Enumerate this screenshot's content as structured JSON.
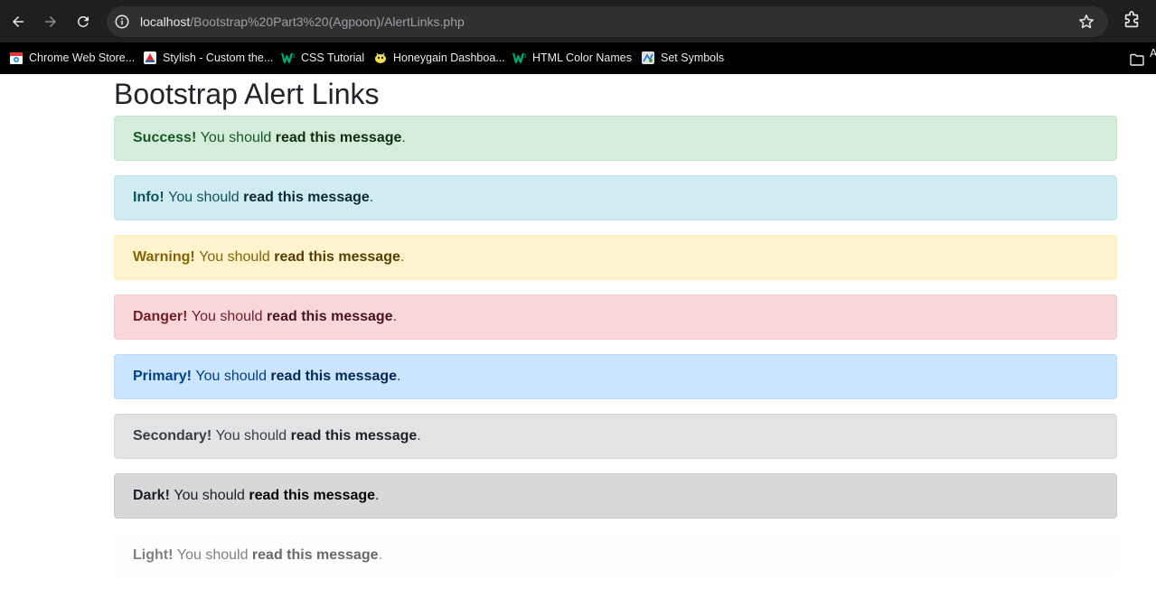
{
  "browser": {
    "url_host": "localhost",
    "url_path": "/Bootstrap%20Part3%20(Agpoon)/AlertLinks.php",
    "bookmarks": [
      {
        "label": "Chrome Web Store...",
        "icon": "chrome-web-store-icon"
      },
      {
        "label": "Stylish - Custom the...",
        "icon": "stylish-icon"
      },
      {
        "label": "CSS Tutorial",
        "icon": "w3schools-icon"
      },
      {
        "label": "Honeygain Dashboa...",
        "icon": "honeygain-icon"
      },
      {
        "label": "HTML Color Names",
        "icon": "w3schools-icon"
      },
      {
        "label": "Set Symbols",
        "icon": "set-symbols-icon"
      }
    ],
    "bookmarks_overflow": "A"
  },
  "page": {
    "title": "Bootstrap Alert Links",
    "alerts": [
      {
        "variant": "success",
        "strong": "Success!",
        "text": "You should",
        "link": "read this message",
        "end": "."
      },
      {
        "variant": "info",
        "strong": "Info!",
        "text": "You should",
        "link": "read this message",
        "end": "."
      },
      {
        "variant": "warning",
        "strong": "Warning!",
        "text": "You should",
        "link": "read this message",
        "end": "."
      },
      {
        "variant": "danger",
        "strong": "Danger!",
        "text": "You should",
        "link": "read this message",
        "end": "."
      },
      {
        "variant": "primary",
        "strong": "Primary!",
        "text": "You should",
        "link": "read this message",
        "end": "."
      },
      {
        "variant": "secondary",
        "strong": "Secondary!",
        "text": "You should",
        "link": "read this message",
        "end": "."
      },
      {
        "variant": "dark",
        "strong": "Dark!",
        "text": "You should",
        "link": "read this message",
        "end": "."
      },
      {
        "variant": "light",
        "strong": "Light!",
        "text": "You should",
        "link": "read this message",
        "end": "."
      }
    ]
  },
  "colors": {
    "toolbar_bg": "#1f1f1f",
    "bookmarks_bg": "#000000",
    "success_bg": "#d4edda",
    "info_bg": "#d1ecf1",
    "warning_bg": "#fff3cd",
    "danger_bg": "#f8d7da",
    "primary_bg": "#cce5ff",
    "secondary_bg": "#e2e3e5",
    "dark_bg": "#d6d8d9",
    "light_bg": "#fefefe"
  }
}
